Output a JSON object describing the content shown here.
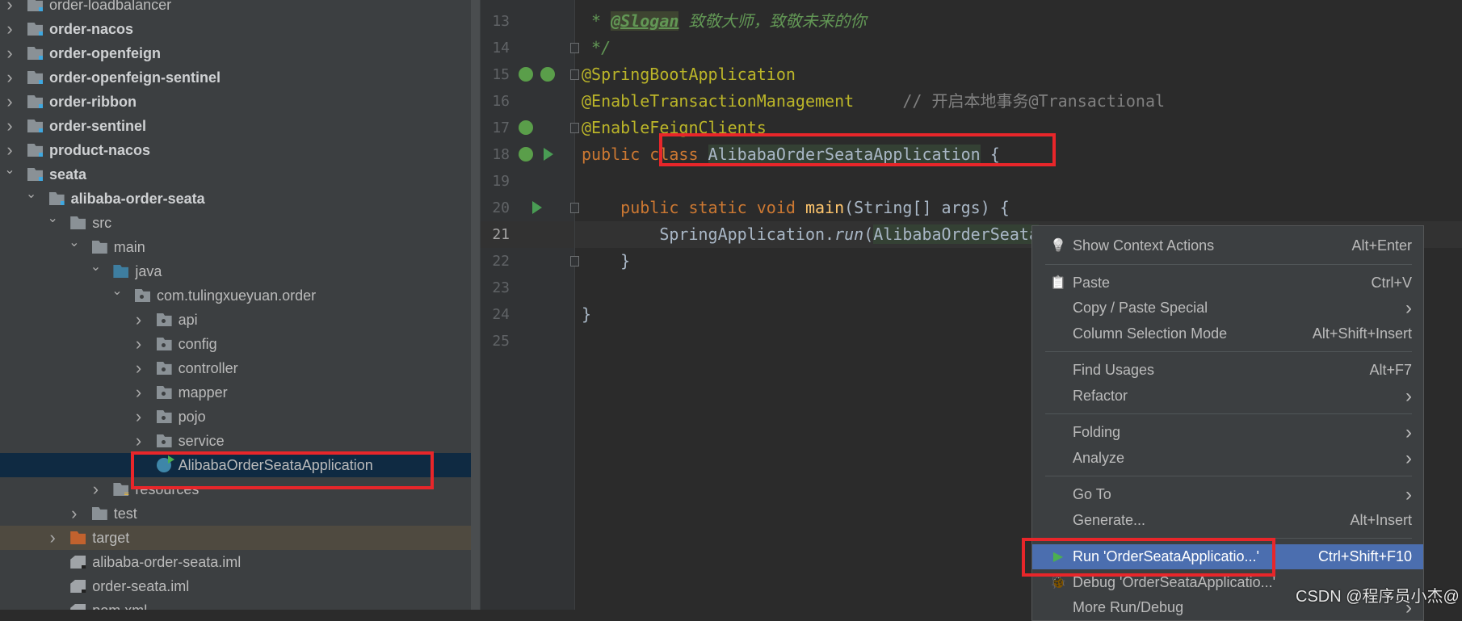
{
  "project_tree": [
    {
      "label": "order-loadbalancer",
      "depth": 0,
      "chevron": "right",
      "icon": "module-folder",
      "bold": false
    },
    {
      "label": "order-nacos",
      "depth": 0,
      "chevron": "right",
      "icon": "module-folder",
      "bold": true
    },
    {
      "label": "order-openfeign",
      "depth": 0,
      "chevron": "right",
      "icon": "module-folder",
      "bold": true
    },
    {
      "label": "order-openfeign-sentinel",
      "depth": 0,
      "chevron": "right",
      "icon": "module-folder",
      "bold": true
    },
    {
      "label": "order-ribbon",
      "depth": 0,
      "chevron": "right",
      "icon": "module-folder",
      "bold": true
    },
    {
      "label": "order-sentinel",
      "depth": 0,
      "chevron": "right",
      "icon": "module-folder",
      "bold": true
    },
    {
      "label": "product-nacos",
      "depth": 0,
      "chevron": "right",
      "icon": "module-folder",
      "bold": true
    },
    {
      "label": "seata",
      "depth": 0,
      "chevron": "down",
      "icon": "module-folder",
      "bold": true
    },
    {
      "label": "alibaba-order-seata",
      "depth": 1,
      "chevron": "down",
      "icon": "module-folder",
      "bold": true
    },
    {
      "label": "src",
      "depth": 2,
      "chevron": "down",
      "icon": "folder",
      "bold": false
    },
    {
      "label": "main",
      "depth": 3,
      "chevron": "down",
      "icon": "folder",
      "bold": false
    },
    {
      "label": "java",
      "depth": 4,
      "chevron": "down",
      "icon": "source-folder",
      "bold": false
    },
    {
      "label": "com.tulingxueyuan.order",
      "depth": 5,
      "chevron": "down",
      "icon": "package",
      "bold": false
    },
    {
      "label": "api",
      "depth": 6,
      "chevron": "right",
      "icon": "package",
      "bold": false
    },
    {
      "label": "config",
      "depth": 6,
      "chevron": "right",
      "icon": "package",
      "bold": false
    },
    {
      "label": "controller",
      "depth": 6,
      "chevron": "right",
      "icon": "package",
      "bold": false
    },
    {
      "label": "mapper",
      "depth": 6,
      "chevron": "right",
      "icon": "package",
      "bold": false
    },
    {
      "label": "pojo",
      "depth": 6,
      "chevron": "right",
      "icon": "package",
      "bold": false
    },
    {
      "label": "service",
      "depth": 6,
      "chevron": "right",
      "icon": "package",
      "bold": false
    },
    {
      "label": "AlibabaOrderSeataApplication",
      "depth": 6,
      "chevron": "none",
      "icon": "spring-boot-class",
      "bold": false,
      "selected": true
    },
    {
      "label": "resources",
      "depth": 4,
      "chevron": "right",
      "icon": "resources-folder",
      "bold": false
    },
    {
      "label": "test",
      "depth": 3,
      "chevron": "right",
      "icon": "folder",
      "bold": false
    },
    {
      "label": "target",
      "depth": 2,
      "chevron": "right",
      "icon": "excluded-folder",
      "bold": false,
      "excluded": true
    },
    {
      "label": "alibaba-order-seata.iml",
      "depth": 2,
      "chevron": "none",
      "icon": "iml-file",
      "bold": false
    },
    {
      "label": "order-seata.iml",
      "depth": 2,
      "chevron": "none",
      "icon": "iml-file",
      "bold": false
    },
    {
      "label": "pom.xml",
      "depth": 2,
      "chevron": "none",
      "icon": "maven-file",
      "bold": false
    }
  ],
  "editor": {
    "current_line": 21,
    "lines": [
      {
        "n": "13",
        "tokens": [
          {
            "t": " * ",
            "c": "doc"
          },
          {
            "t": "@Slogan",
            "c": "tag"
          },
          {
            "t": " 致敬大师，致敬未来的你",
            "c": "doc"
          }
        ]
      },
      {
        "n": "14",
        "tokens": [
          {
            "t": " */",
            "c": "doc"
          }
        ]
      },
      {
        "n": "15",
        "gutter": [
          "spring-bean",
          "spring-bean-check"
        ],
        "tokens": [
          {
            "t": "@SpringBootApplication",
            "c": "ann"
          }
        ]
      },
      {
        "n": "16",
        "tokens": [
          {
            "t": "@EnableTransactionManagement",
            "c": "ann"
          },
          {
            "t": "     // 开启本地事务@Transactional",
            "c": "cm"
          }
        ]
      },
      {
        "n": "17",
        "gutter": [
          "spring-bean"
        ],
        "tokens": [
          {
            "t": "@EnableFeignClients",
            "c": "ann"
          }
        ]
      },
      {
        "n": "18",
        "gutter": [
          "spring-bean",
          "run"
        ],
        "tokens": [
          {
            "t": "public class ",
            "c": "kw"
          },
          {
            "t": "AlibabaOrderSeataApplication",
            "c": "hl"
          },
          {
            "t": " {",
            "c": ""
          }
        ]
      },
      {
        "n": "19",
        "tokens": []
      },
      {
        "n": "20",
        "gutter": [
          "run"
        ],
        "tokens": [
          {
            "t": "    public static void ",
            "c": "kw"
          },
          {
            "t": "main",
            "c": "fn"
          },
          {
            "t": "(String[] args) {",
            "c": ""
          }
        ]
      },
      {
        "n": "21",
        "tokens": [
          {
            "t": "        SpringApplication.",
            "c": ""
          },
          {
            "t": "run",
            "c": "it"
          },
          {
            "t": "(",
            "c": ""
          },
          {
            "t": "AlibabaOrderSeata",
            "c": "hl"
          }
        ]
      },
      {
        "n": "22",
        "tokens": [
          {
            "t": "    }",
            "c": ""
          }
        ]
      },
      {
        "n": "23",
        "tokens": []
      },
      {
        "n": "24",
        "tokens": [
          {
            "t": "}",
            "c": ""
          }
        ]
      },
      {
        "n": "25",
        "tokens": []
      }
    ]
  },
  "context_menu": {
    "items": [
      {
        "label": "Show Context Actions",
        "shortcut": "Alt+Enter",
        "icon": "lightbulb-icon"
      },
      {
        "sep": true
      },
      {
        "label": "Paste",
        "shortcut": "Ctrl+V",
        "icon": "clipboard-icon"
      },
      {
        "label": "Copy / Paste Special",
        "shortcut": "›"
      },
      {
        "label": "Column Selection Mode",
        "shortcut": "Alt+Shift+Insert"
      },
      {
        "sep": true
      },
      {
        "label": "Find Usages",
        "shortcut": "Alt+F7"
      },
      {
        "label": "Refactor",
        "shortcut": "›"
      },
      {
        "sep": true
      },
      {
        "label": "Folding",
        "shortcut": "›"
      },
      {
        "label": "Analyze",
        "shortcut": "›"
      },
      {
        "sep": true
      },
      {
        "label": "Go To",
        "shortcut": "›"
      },
      {
        "label": "Generate...",
        "shortcut": "Alt+Insert"
      },
      {
        "sep": true
      },
      {
        "label": "Run 'OrderSeataApplicatio...'",
        "shortcut": "Ctrl+Shift+F10",
        "icon": "run-icon",
        "highlighted": true
      },
      {
        "label": "Debug 'OrderSeataApplicatio...'",
        "shortcut": "",
        "icon": "debug-icon"
      },
      {
        "label": "More Run/Debug",
        "shortcut": "›"
      }
    ]
  },
  "watermark": "CSDN @程序员小杰@",
  "colors": {
    "accent_highlight": "#4b6eaf",
    "annotation_box": "#e8262a"
  }
}
